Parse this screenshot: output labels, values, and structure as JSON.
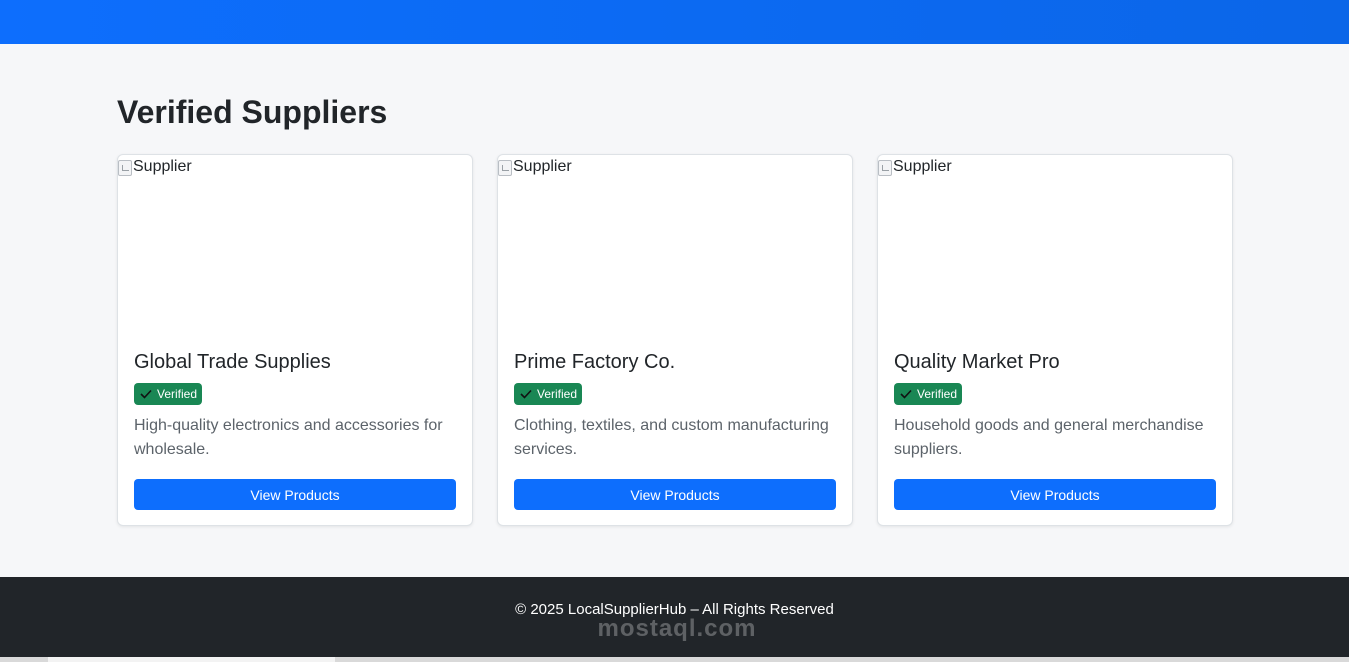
{
  "section": {
    "title": "Verified Suppliers"
  },
  "suppliers": [
    {
      "image_alt": "Supplier",
      "name": "Global Trade Supplies",
      "badge": "Verified",
      "description": "High-quality electronics and accessories for wholesale.",
      "button": "View Products"
    },
    {
      "image_alt": "Supplier",
      "name": "Prime Factory Co.",
      "badge": "Verified",
      "description": "Clothing, textiles, and custom manufacturing services.",
      "button": "View Products"
    },
    {
      "image_alt": "Supplier",
      "name": "Quality Market Pro",
      "badge": "Verified",
      "description": "Household goods and general merchandise suppliers.",
      "button": "View Products"
    }
  ],
  "footer": {
    "copyright": "© 2025 LocalSupplierHub – All Rights Reserved",
    "watermark": "mostaql.com"
  },
  "colors": {
    "primary": "#0d6efd",
    "success": "#198754",
    "footer_bg": "#212529",
    "page_bg": "#f6f7f9"
  },
  "icons": {
    "badge_icon": "check-icon",
    "image_icon": "broken-image-icon"
  }
}
